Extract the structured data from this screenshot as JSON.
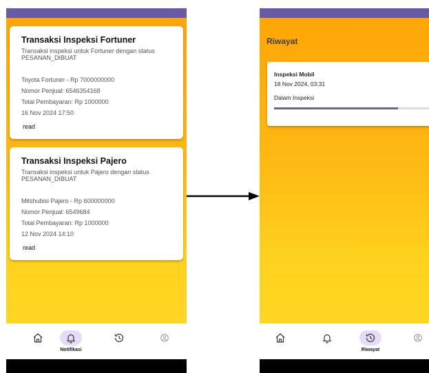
{
  "left_screen": {
    "notifications": [
      {
        "title": "Transaksi Inspeksi Fortuner",
        "description": "Transaksi inspeksi untuk Fortuner dengan status PESANAN_DIBUAT",
        "car_price": "Toyota Fortuner - Rp 7000000000",
        "seller_number": "Nomor Penjual: 6546354168",
        "total_payment": "Total Pembayaran: Rp 1000000",
        "datetime": "16 Nov 2024 17:50",
        "read_label": "read"
      },
      {
        "title": "Transaksi Inspeksi Pajero",
        "description": "Transaksi inspeksi untuk Pajero dengan status PESANAN_DIBUAT",
        "car_price": "Mitshubisi Pajero - Rp 600000000",
        "seller_number": "Nomor Penjual: 6549684",
        "total_payment": "Total Pembayaran: Rp 1000000",
        "datetime": "12 Nov 2024 14:10",
        "read_label": "read"
      }
    ],
    "nav": {
      "active_label": "Notifikasi",
      "icons": [
        "home-icon",
        "bell-icon",
        "history-icon",
        "profile-icon"
      ]
    }
  },
  "right_screen": {
    "title": "Riwayat",
    "history_item": {
      "title": "Inspeksi Mobil",
      "datetime": "18 Nov 2024, 03:31",
      "status": "Dalam Inspeksi",
      "progress": 0.75
    },
    "nav": {
      "active_label": "Riwayat",
      "icons": [
        "home-icon",
        "bell-icon",
        "history-icon",
        "profile-icon"
      ]
    }
  },
  "colors": {
    "status_bar": "#6a5aa5",
    "gradient_top": "#ffa607",
    "gradient_bottom": "#ffd624",
    "active_pill": "#e7dcf7",
    "progress_fill": "#6a6688",
    "progress_track": "#dcdcdc"
  }
}
